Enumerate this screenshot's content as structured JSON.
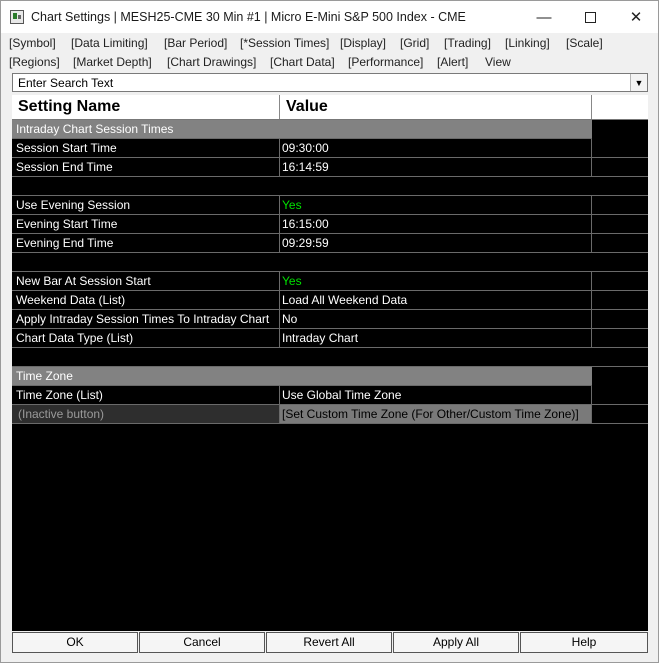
{
  "window": {
    "title": "Chart Settings | MESH25-CME  30 Min  #1 | Micro E-Mini S&P 500 Index - CME",
    "minimize": "—",
    "close": "✕"
  },
  "menu_row1": [
    "[Symbol]",
    "[Data Limiting]",
    "[Bar Period]",
    "[*Session Times]",
    "[Display]",
    "[Grid]",
    "[Trading]",
    "[Linking]",
    "[Scale]"
  ],
  "menu_row2": [
    "[Regions]",
    "[Market Depth]",
    "[Chart Drawings]",
    "[Chart Data]",
    "[Performance]",
    "[Alert]",
    "View"
  ],
  "search": {
    "text": "Enter Search Text",
    "dropdown_glyph": "▼"
  },
  "table": {
    "headers": {
      "name": "Setting Name",
      "value": "Value"
    },
    "sections": {
      "intraday": "Intraday Chart Session Times",
      "timezone": "Time Zone"
    },
    "rows": [
      {
        "name": "Session Start Time",
        "value": "09:30:00"
      },
      {
        "name": "Session End Time",
        "value": "16:14:59"
      },
      {
        "name": "Use Evening Session",
        "value": "Yes"
      },
      {
        "name": "Evening Start Time",
        "value": "16:15:00"
      },
      {
        "name": "Evening End Time",
        "value": "09:29:59"
      },
      {
        "name": "New Bar At Session Start",
        "value": "Yes"
      },
      {
        "name": "Weekend Data (List)",
        "value": "Load All Weekend Data"
      },
      {
        "name": "Apply Intraday Session Times To Intraday Chart",
        "value": "No"
      },
      {
        "name": "Chart Data Type (List)",
        "value": "Intraday Chart"
      },
      {
        "name": "Time Zone (List)",
        "value": "Use Global Time Zone"
      },
      {
        "name": "(Inactive button)",
        "value": "[Set Custom Time Zone (For Other/Custom Time Zone)]"
      }
    ],
    "colors": {
      "yes_green": "#00e000",
      "section_gray": "#828282"
    }
  },
  "buttons": {
    "ok": "OK",
    "cancel": "Cancel",
    "revert_all": "Revert All",
    "apply_all": "Apply All",
    "help": "Help"
  }
}
